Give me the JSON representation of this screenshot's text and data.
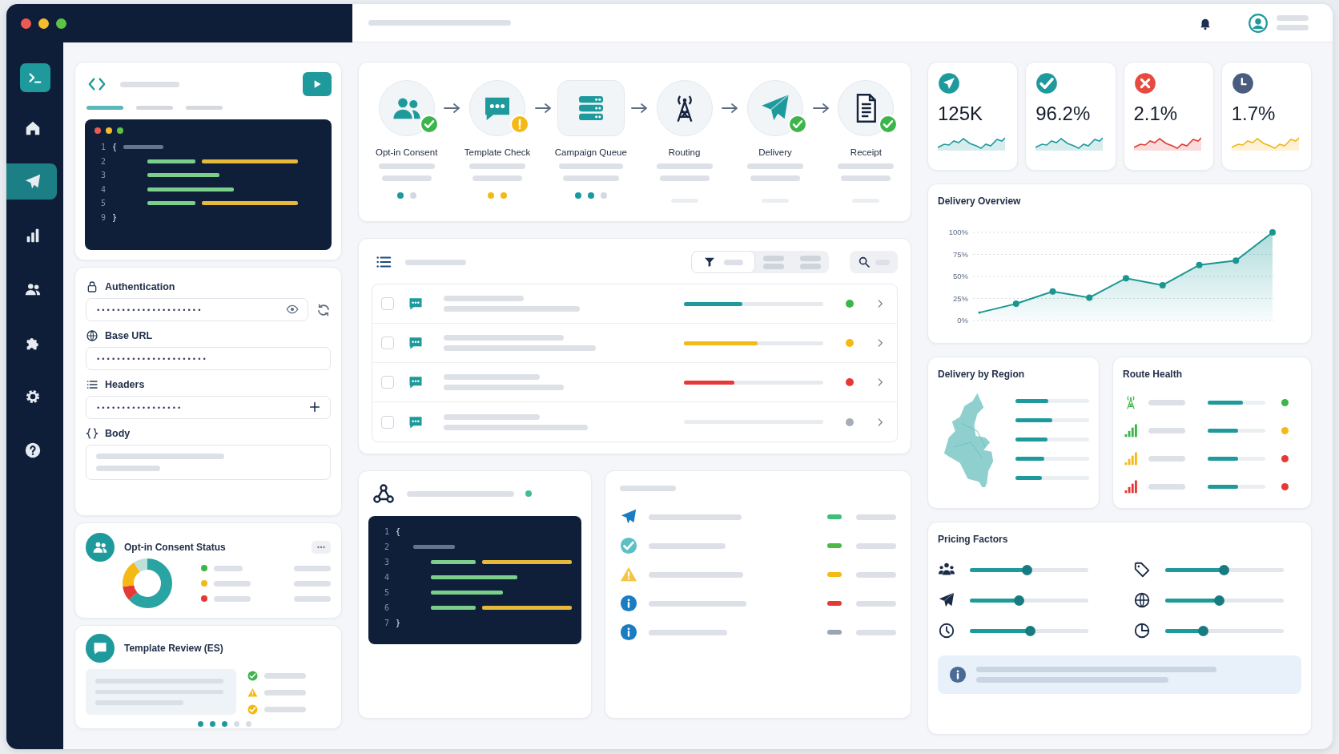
{
  "window": {
    "controls": [
      {
        "kind": "close"
      },
      {
        "kind": "minimize"
      },
      {
        "kind": "zoom"
      }
    ]
  },
  "sidebar": {
    "items": [
      {
        "kind": "home",
        "selected": false
      },
      {
        "kind": "send",
        "selected": true
      },
      {
        "kind": "analytics",
        "selected": false
      },
      {
        "kind": "contacts",
        "selected": false
      },
      {
        "kind": "integrations",
        "selected": false
      },
      {
        "kind": "settings",
        "selected": false
      },
      {
        "kind": "help",
        "selected": false
      }
    ]
  },
  "request_editor": {
    "tabs": [
      {
        "selected": true
      },
      {
        "selected": false
      },
      {
        "selected": false
      }
    ],
    "code_lines": [
      {
        "number": "1",
        "kind": "brace-mask",
        "text": "{"
      },
      {
        "number": "2",
        "kind": "pair"
      },
      {
        "number": "3",
        "kind": "string"
      },
      {
        "number": "4",
        "kind": "string"
      },
      {
        "number": "5",
        "kind": "pair"
      },
      {
        "number": "9",
        "kind": "brace",
        "text": "}"
      }
    ]
  },
  "request_form": {
    "fields": [
      {
        "kind": "secret",
        "label": "Authentication",
        "value": "•••••••••••••••••••••"
      },
      {
        "kind": "url",
        "label": "Base URL",
        "value": "••••••••••••••••••••••"
      },
      {
        "kind": "headers",
        "label": "Headers",
        "value": "•••••••••••••••••"
      },
      {
        "kind": "body",
        "label": "Body"
      }
    ]
  },
  "consent_status": {
    "title": "Opt-in Consent Status",
    "legend": [
      {
        "color": "#3cb54a"
      },
      {
        "color": "#f5b915"
      },
      {
        "color": "#e53935"
      }
    ]
  },
  "template_review": {
    "title": "Template Review (ES)",
    "checks": [
      {
        "kind": "ok"
      },
      {
        "kind": "warning"
      },
      {
        "kind": "pending"
      }
    ],
    "progress_dots": [
      {
        "done": true
      },
      {
        "done": true
      },
      {
        "done": true
      },
      {
        "done": false
      },
      {
        "done": false
      }
    ]
  },
  "pipeline": {
    "steps": [
      {
        "label": "Opt-in Consent",
        "kind": "consent",
        "done": true,
        "warning": false,
        "dots": [
          {
            "color": "#1a9aa0"
          },
          {
            "color": "#d5d9df"
          }
        ]
      },
      {
        "label": "Template Check",
        "kind": "template",
        "done": false,
        "warning": true,
        "dots": [
          {
            "color": "#f5b915"
          },
          {
            "color": "#f5b915"
          }
        ]
      },
      {
        "label": "Campaign Queue",
        "kind": "queue",
        "done": false,
        "warning": false,
        "dots": [
          {
            "color": "#1a9aa0"
          },
          {
            "color": "#1a9aa0"
          },
          {
            "color": "#d5d9df"
          }
        ]
      },
      {
        "label": "Routing",
        "kind": "routing",
        "done": false,
        "warning": false
      },
      {
        "label": "Delivery",
        "kind": "delivery",
        "done": true,
        "warning": false
      },
      {
        "label": "Receipt",
        "kind": "receipt",
        "done": true,
        "warning": false
      }
    ]
  },
  "messages": {
    "rows": [
      {
        "checked": false,
        "kind": "ok",
        "level": 0.42,
        "color": "#3cb54a"
      },
      {
        "checked": false,
        "kind": "warning",
        "level": 0.53,
        "color": "#f5b915"
      },
      {
        "checked": false,
        "kind": "error",
        "level": 0.36,
        "color": "#e53935"
      },
      {
        "checked": false,
        "kind": "idle",
        "color": "#a6adb6"
      }
    ]
  },
  "webhook": {
    "color": "#3fbf8f",
    "code_lines": [
      {
        "number": "1",
        "kind": "brace",
        "text": "{"
      },
      {
        "number": "2",
        "kind": "mask"
      },
      {
        "number": "3",
        "kind": "pair"
      },
      {
        "number": "4",
        "kind": "string"
      },
      {
        "number": "5",
        "kind": "string"
      },
      {
        "number": "6",
        "kind": "pair"
      },
      {
        "number": "7",
        "kind": "brace",
        "text": "}"
      }
    ]
  },
  "events": {
    "items": [
      {
        "kind": "sent",
        "color": "#3cbf7a"
      },
      {
        "kind": "delivered",
        "color": "#4cb848"
      },
      {
        "kind": "warning",
        "color": "#f5b915"
      },
      {
        "kind": "info",
        "color": "#e53935"
      },
      {
        "kind": "info",
        "color": "#9aa5b1"
      }
    ]
  },
  "kpis": [
    {
      "kind": "sent",
      "value": "125K"
    },
    {
      "kind": "delivered",
      "value": "96.2%"
    },
    {
      "kind": "failed",
      "value": "2.1%"
    },
    {
      "kind": "pending",
      "value": "1.7%"
    }
  ],
  "delivery_overview": {
    "title": "Delivery Overview",
    "chart_data": {
      "type": "area",
      "grid": true,
      "marker": true,
      "values": [
        9,
        19,
        33,
        26,
        48,
        40,
        63,
        68,
        100
      ],
      "ylim": [
        0,
        100
      ],
      "yticks": [
        {
          "value": 0,
          "label": "0%"
        },
        {
          "value": 25,
          "label": "25%"
        },
        {
          "value": 50,
          "label": "50%"
        },
        {
          "value": 75,
          "label": "75%"
        },
        {
          "value": 100,
          "label": "100%"
        }
      ]
    }
  },
  "delivery_by_region": {
    "title": "Delivery by Region",
    "regions": [
      {
        "level": 0.45
      },
      {
        "level": 0.5
      },
      {
        "level": 0.44
      },
      {
        "level": 0.39
      },
      {
        "level": 0.36
      }
    ]
  },
  "route_health": {
    "title": "Route Health",
    "routes": [
      {
        "kind": "tower",
        "level": 0.61,
        "color": "#3cb54a"
      },
      {
        "kind": "signal-high",
        "level": 0.53,
        "color": "#f5b915"
      },
      {
        "kind": "signal-mid",
        "level": 0.53,
        "color": "#e53935"
      },
      {
        "kind": "signal-low",
        "level": 0.53,
        "color": "#e53935"
      }
    ]
  },
  "pricing_factors": {
    "title": "Pricing Factors",
    "sliders": [
      {
        "kind": "audience",
        "level": 0.48
      },
      {
        "kind": "tag",
        "level": 0.49
      },
      {
        "kind": "send",
        "level": 0.41
      },
      {
        "kind": "globe",
        "level": 0.45
      },
      {
        "kind": "clock",
        "level": 0.51
      },
      {
        "kind": "share",
        "level": 0.32
      }
    ]
  }
}
